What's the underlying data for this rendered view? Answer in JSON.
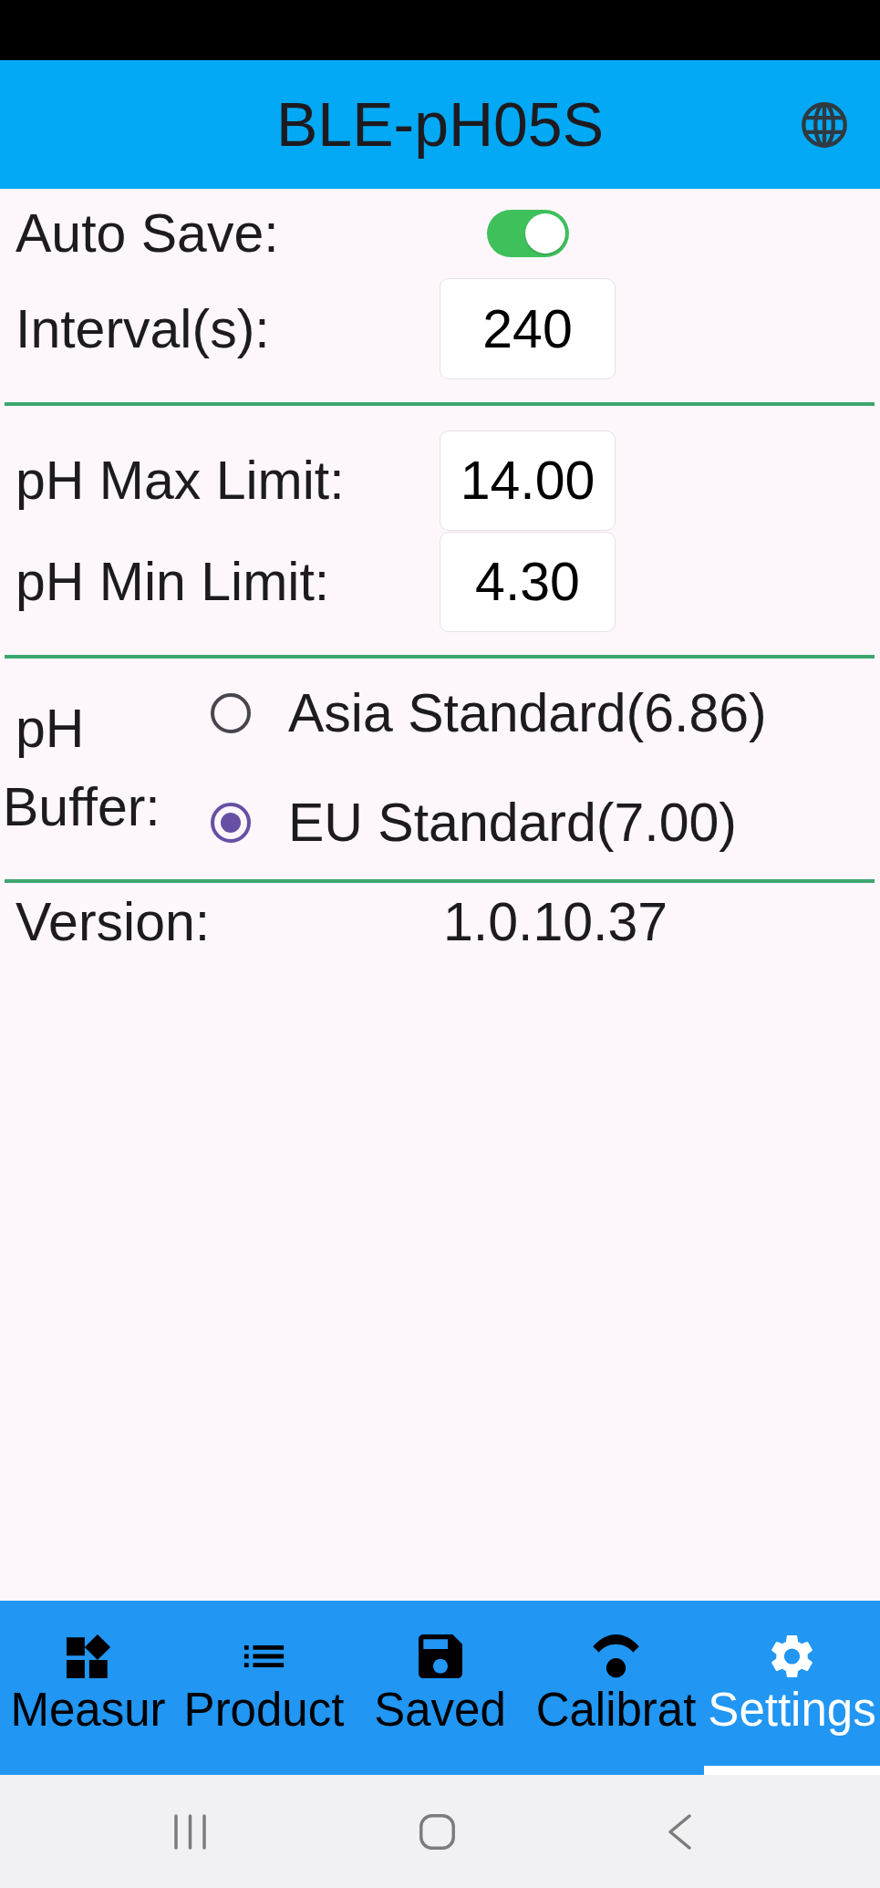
{
  "app_bar": {
    "title": "BLE-pH05S"
  },
  "settings": {
    "auto_save": {
      "label": "Auto Save:",
      "on": true
    },
    "interval": {
      "label": "Interval(s):",
      "value": "240"
    },
    "ph_max_limit": {
      "label": "pH Max Limit:",
      "value": "14.00"
    },
    "ph_min_limit": {
      "label": "pH Min Limit:",
      "value": "4.30"
    },
    "ph_buffer": {
      "label_lines": [
        "pH",
        "Buffer:"
      ],
      "options": [
        {
          "label": "Asia Standard(6.86)",
          "selected": false
        },
        {
          "label": "EU Standard(7.00)",
          "selected": true
        }
      ]
    },
    "version": {
      "label": "Version:",
      "value": "1.0.10.37"
    }
  },
  "bottom_nav": {
    "tabs": [
      {
        "label": "Measur",
        "selected": false
      },
      {
        "label": "Product",
        "selected": false
      },
      {
        "label": "Saved",
        "selected": false
      },
      {
        "label": "Calibrat",
        "selected": false
      },
      {
        "label": "Settings",
        "selected": true
      }
    ]
  }
}
